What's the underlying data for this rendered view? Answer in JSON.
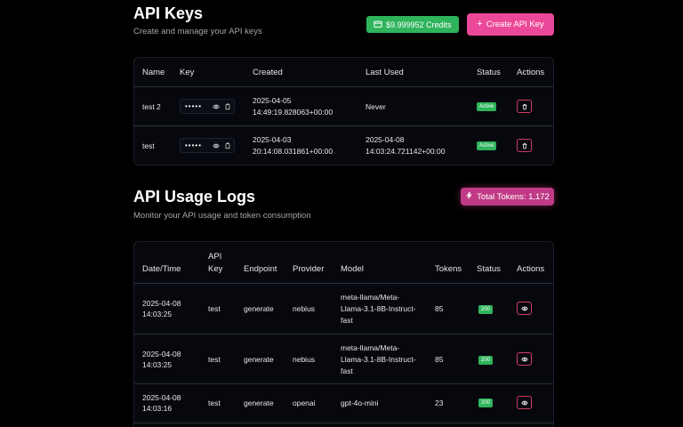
{
  "api_keys": {
    "title": "API Keys",
    "subtitle": "Create and manage your API keys",
    "credits_label": "$9.999952 Credits",
    "create_button": "Create API Key",
    "columns": [
      "Name",
      "Key",
      "Created",
      "Last Used",
      "Status",
      "Actions"
    ],
    "rows": [
      {
        "name": "test 2",
        "key_mask": "•••••",
        "created_date": "2025-04-05",
        "created_time": "14:49:19.828063+00:00",
        "last_used_date": "Never",
        "last_used_time": "",
        "status": "Active"
      },
      {
        "name": "test",
        "key_mask": "•••••",
        "created_date": "2025-04-03",
        "created_time": "20:14:08.031861+00:00",
        "last_used_date": "2025-04-08",
        "last_used_time": "14:03:24.721142+00:00",
        "status": "Active"
      }
    ]
  },
  "usage_logs": {
    "title": "API Usage Logs",
    "subtitle": "Monitor your API usage and token consumption",
    "total_tokens": "Total Tokens: 1,172",
    "columns": {
      "datetime": "Date/Time",
      "api_key_1": "API",
      "api_key_2": "Key",
      "endpoint": "Endpoint",
      "provider": "Provider",
      "model": "Model",
      "tokens": "Tokens",
      "status": "Status",
      "actions": "Actions"
    },
    "rows": [
      {
        "date": "2025-04-08",
        "time": "14:03:25",
        "key": "test",
        "endpoint": "generate",
        "provider": "nebius",
        "model_1": "meta-llama/Meta-",
        "model_2": "Llama-3.1-8B-Instruct-",
        "model_3": "fast",
        "tokens": "85",
        "status": "200"
      },
      {
        "date": "2025-04-08",
        "time": "14:03:25",
        "key": "test",
        "endpoint": "generate",
        "provider": "nebius",
        "model_1": "meta-llama/Meta-",
        "model_2": "Llama-3.1-8B-Instruct-",
        "model_3": "fast",
        "tokens": "85",
        "status": "200"
      },
      {
        "date": "2025-04-08",
        "time": "14:03:16",
        "key": "test",
        "endpoint": "generate",
        "provider": "openai",
        "model_1": "gpt-4o-mini",
        "model_2": "",
        "model_3": "",
        "tokens": "23",
        "status": "200"
      }
    ]
  },
  "colors": {
    "accent": "#ec4899",
    "success": "#2fb45c",
    "danger": "#d23b62",
    "background": "#000000"
  },
  "icons": {
    "credits": "wallet-icon",
    "create": "plus-icon",
    "tokens": "zap-icon",
    "view": "eye-icon",
    "copy": "copy-icon",
    "delete": "trash-icon"
  }
}
